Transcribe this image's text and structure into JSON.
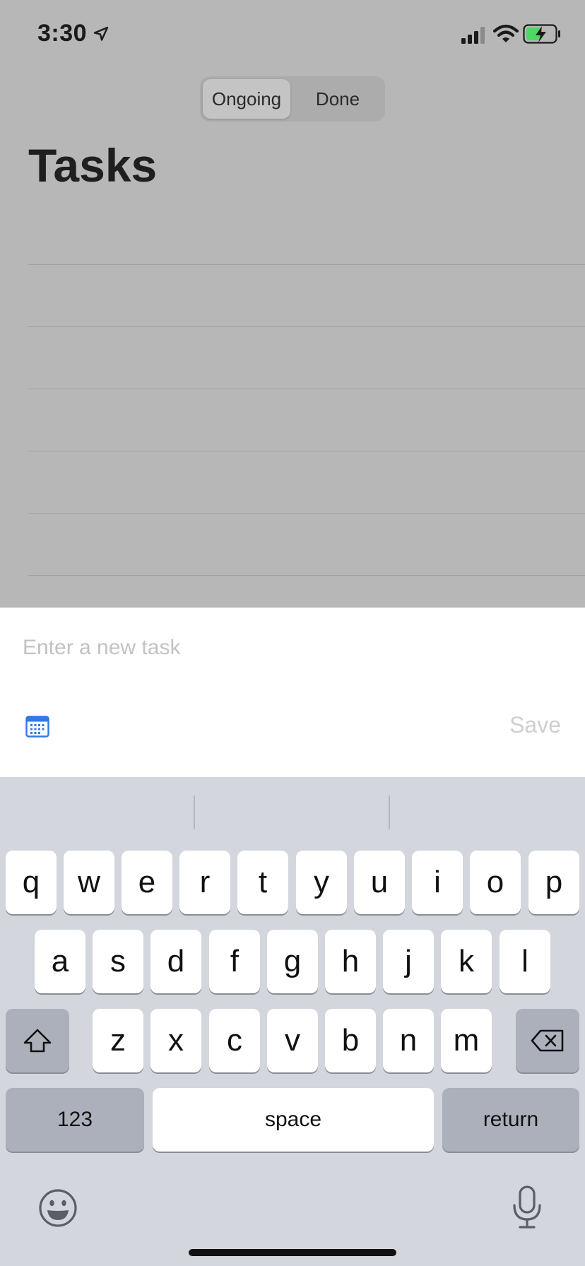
{
  "status_bar": {
    "time": "3:30"
  },
  "segmented_control": {
    "ongoing_label": "Ongoing",
    "done_label": "Done"
  },
  "page": {
    "title": "Tasks"
  },
  "new_task": {
    "placeholder": "Enter a new task",
    "save_label": "Save"
  },
  "keyboard": {
    "row1": [
      "q",
      "w",
      "e",
      "r",
      "t",
      "y",
      "u",
      "i",
      "o",
      "p"
    ],
    "row2": [
      "a",
      "s",
      "d",
      "f",
      "g",
      "h",
      "j",
      "k",
      "l"
    ],
    "row3": [
      "z",
      "x",
      "c",
      "v",
      "b",
      "n",
      "m"
    ],
    "numbers_label": "123",
    "space_label": "space",
    "return_label": "return"
  },
  "icons": {
    "location": "location-arrow-icon",
    "signal": "cellular-signal-icon",
    "wifi": "wifi-icon",
    "battery": "battery-charging-icon",
    "calendar": "calendar-icon",
    "shift": "shift-icon",
    "backspace": "backspace-icon",
    "emoji": "emoji-icon",
    "microphone": "microphone-icon"
  },
  "colors": {
    "accent": "#2f7ae5",
    "battery_fill": "#4cd964"
  }
}
